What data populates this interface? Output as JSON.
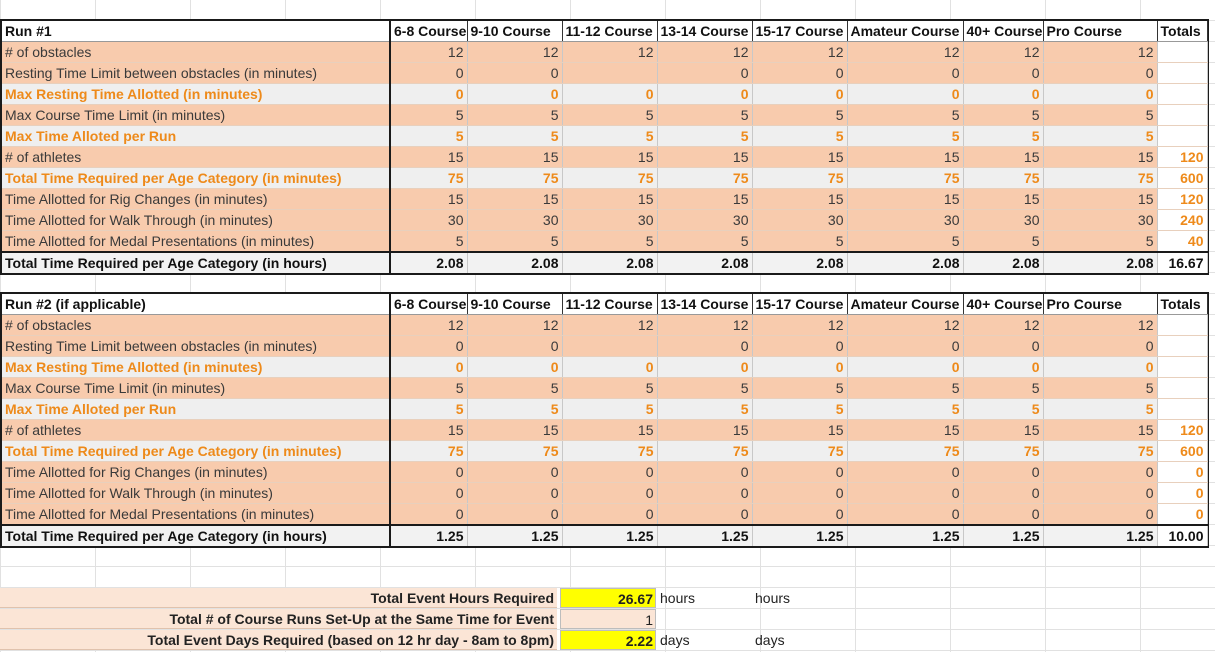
{
  "sheet": {
    "course_headers": [
      "6-8 Course",
      "9-10 Course",
      "11-12 Course",
      "13-14 Course",
      "15-17 Course",
      "Amateur Course",
      "40+ Course",
      "Pro Course"
    ],
    "totals_header": "Totals",
    "run1": {
      "title": "Run #1",
      "rows": [
        {
          "label": "# of obstacles",
          "style": "peach",
          "values": [
            "12",
            "12",
            "12",
            "12",
            "12",
            "12",
            "12",
            "12"
          ],
          "total": ""
        },
        {
          "label": "Resting Time Limit between obstacles (in minutes)",
          "style": "peach",
          "values": [
            "0",
            "0",
            "",
            "0",
            "0",
            "0",
            "0",
            "0"
          ],
          "total": ""
        },
        {
          "label": "Max Resting Time Allotted (in minutes)",
          "style": "gray hl",
          "values": [
            "0",
            "0",
            "0",
            "0",
            "0",
            "0",
            "0",
            "0"
          ],
          "total": ""
        },
        {
          "label": "Max Course Time Limit (in minutes)",
          "style": "peach",
          "values": [
            "5",
            "5",
            "5",
            "5",
            "5",
            "5",
            "5",
            "5"
          ],
          "total": ""
        },
        {
          "label": "Max Time Alloted per Run",
          "style": "gray hl",
          "values": [
            "5",
            "5",
            "5",
            "5",
            "5",
            "5",
            "5",
            "5"
          ],
          "total": ""
        },
        {
          "label": "# of athletes",
          "style": "peach",
          "values": [
            "15",
            "15",
            "15",
            "15",
            "15",
            "15",
            "15",
            "15"
          ],
          "total": "120"
        },
        {
          "label": "Total Time Required per Age Category (in minutes)",
          "style": "gray hl",
          "values": [
            "75",
            "75",
            "75",
            "75",
            "75",
            "75",
            "75",
            "75"
          ],
          "total": "600"
        },
        {
          "label": "Time Allotted for Rig Changes (in minutes)",
          "style": "peach",
          "values": [
            "15",
            "15",
            "15",
            "15",
            "15",
            "15",
            "15",
            "15"
          ],
          "total": "120"
        },
        {
          "label": "Time Allotted for Walk Through (in minutes)",
          "style": "peach",
          "values": [
            "30",
            "30",
            "30",
            "30",
            "30",
            "30",
            "30",
            "30"
          ],
          "total": "240"
        },
        {
          "label": "Time Allotted for Medal Presentations (in minutes)",
          "style": "peach",
          "values": [
            "5",
            "5",
            "5",
            "5",
            "5",
            "5",
            "5",
            "5"
          ],
          "total": "40"
        },
        {
          "label": "Total Time Required per Age Category (in hours)",
          "style": "total",
          "values": [
            "2.08",
            "2.08",
            "2.08",
            "2.08",
            "2.08",
            "2.08",
            "2.08",
            "2.08"
          ],
          "total": "16.67"
        }
      ]
    },
    "run2": {
      "title": "Run #2 (if applicable)",
      "rows": [
        {
          "label": "# of obstacles",
          "style": "peach",
          "values": [
            "12",
            "12",
            "12",
            "12",
            "12",
            "12",
            "12",
            "12"
          ],
          "total": ""
        },
        {
          "label": "Resting Time Limit between obstacles (in minutes)",
          "style": "peach",
          "values": [
            "0",
            "0",
            "",
            "0",
            "0",
            "0",
            "0",
            "0"
          ],
          "total": ""
        },
        {
          "label": "Max Resting Time Allotted (in minutes)",
          "style": "gray hl",
          "values": [
            "0",
            "0",
            "0",
            "0",
            "0",
            "0",
            "0",
            "0"
          ],
          "total": ""
        },
        {
          "label": "Max Course Time Limit (in minutes)",
          "style": "peach",
          "values": [
            "5",
            "5",
            "5",
            "5",
            "5",
            "5",
            "5",
            "5"
          ],
          "total": ""
        },
        {
          "label": "Max Time Alloted per Run",
          "style": "gray hl",
          "values": [
            "5",
            "5",
            "5",
            "5",
            "5",
            "5",
            "5",
            "5"
          ],
          "total": ""
        },
        {
          "label": "# of athletes",
          "style": "peach",
          "values": [
            "15",
            "15",
            "15",
            "15",
            "15",
            "15",
            "15",
            "15"
          ],
          "total": "120"
        },
        {
          "label": "Total Time Required per Age Category (in minutes)",
          "style": "gray hl",
          "values": [
            "75",
            "75",
            "75",
            "75",
            "75",
            "75",
            "75",
            "75"
          ],
          "total": "600"
        },
        {
          "label": "Time Allotted for Rig Changes (in minutes)",
          "style": "peach",
          "values": [
            "0",
            "0",
            "0",
            "0",
            "0",
            "0",
            "0",
            "0"
          ],
          "total": "0"
        },
        {
          "label": "Time Allotted for Walk Through (in minutes)",
          "style": "peach",
          "values": [
            "0",
            "0",
            "0",
            "0",
            "0",
            "0",
            "0",
            "0"
          ],
          "total": "0"
        },
        {
          "label": "Time Allotted for Medal Presentations (in minutes)",
          "style": "peach",
          "values": [
            "0",
            "0",
            "0",
            "0",
            "0",
            "0",
            "0",
            "0"
          ],
          "total": "0"
        },
        {
          "label": "Total Time Required per Age Category (in hours)",
          "style": "total",
          "values": [
            "1.25",
            "1.25",
            "1.25",
            "1.25",
            "1.25",
            "1.25",
            "1.25",
            "1.25"
          ],
          "total": "10.00"
        }
      ]
    },
    "summary": [
      {
        "label": "Total Event Hours Required",
        "value": "26.67",
        "value_style": "yellow",
        "unit1": "hours",
        "unit2": "hours"
      },
      {
        "label": "Total # of Course Runs Set-Up at the Same Time for Event",
        "value": "1",
        "value_style": "peach",
        "unit1": "",
        "unit2": ""
      },
      {
        "label": "Total Event Days Required (based on 12 hr day - 8am to 8pm)",
        "value": "2.22",
        "value_style": "yellow",
        "unit1": "days",
        "unit2": "days"
      }
    ]
  },
  "colors": {
    "peach": "#f8cbad",
    "highlight_text": "#ee8a1a",
    "yellow": "#ffff00",
    "gray_row": "#efefef"
  }
}
